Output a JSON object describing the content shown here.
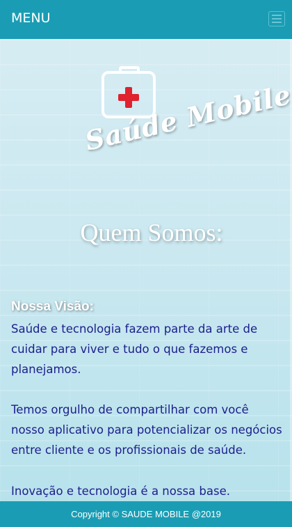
{
  "header": {
    "menu_label": "MENU",
    "menu_toggle_icon": "hamburger-icon"
  },
  "brand": {
    "name": "Saúde Mobile",
    "logo_icon": "first-aid-kit-icon",
    "cross_color": "#e0212e"
  },
  "about": {
    "title": "Quem Somos:",
    "vision_heading": "Nossa Visão:",
    "paragraphs": [
      "Saúde e tecnologia fazem parte da arte de cuidar para viver e tudo o que fazemos e planejamos.",
      "Temos orgulho de compartilhar com você nosso aplicativo para potencializar os negócios entre cliente e os profissionais de saúde.",
      "Inovação e tecnologia é a nossa base."
    ]
  },
  "footer": {
    "copyright": "Copyright © SAUDE MOBILE @2019"
  },
  "colors": {
    "primary": "#1a9db4",
    "text_dark_blue": "#1c1e8c",
    "white": "#ffffff"
  }
}
